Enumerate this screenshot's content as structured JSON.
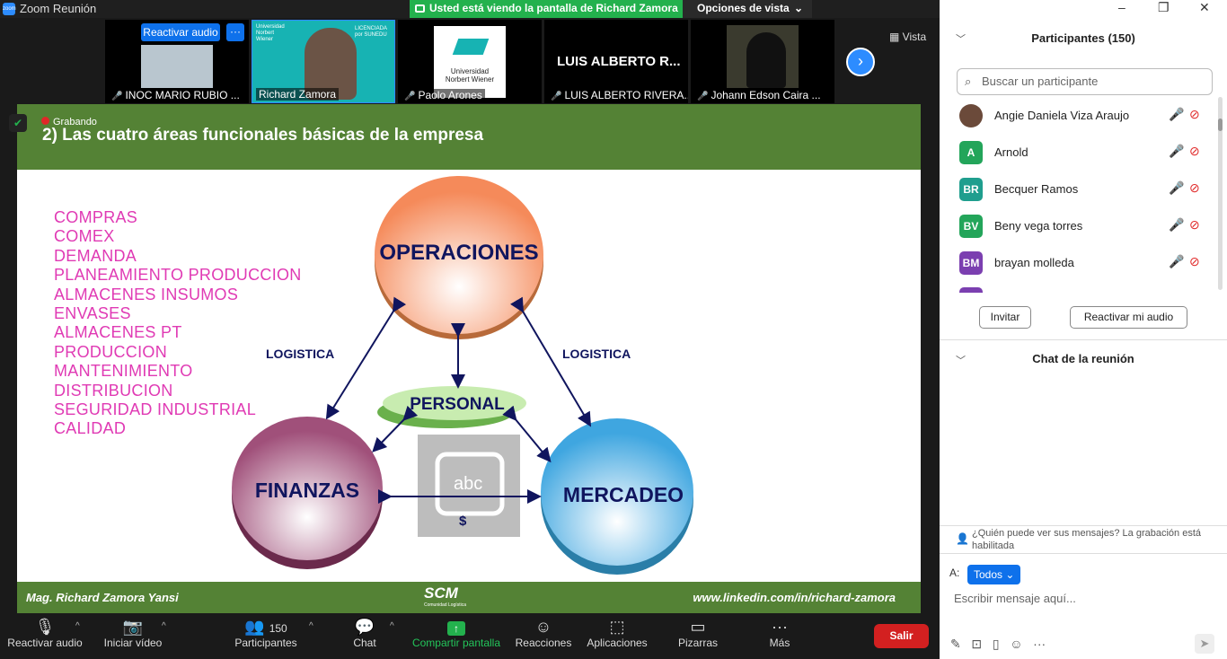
{
  "window": {
    "title": "Zoom Reunión",
    "minimize": "–",
    "restore": "❐",
    "close": "✕"
  },
  "banner": {
    "text": "Usted está viendo la pantalla de Richard Zamora"
  },
  "view_options": {
    "label": "Opciones de vista",
    "caret": "⌄"
  },
  "gallery": {
    "unmute_label": "Reactivar audio",
    "more_label": "···",
    "participants": [
      {
        "name": "INOC MARIO RUBIO ...",
        "muted": true
      },
      {
        "name": "Richard Zamora",
        "muted": false,
        "logo_top": "Universidad Norbert Wiener",
        "logo_right": "LICENCIADA por SUNEDU"
      },
      {
        "name": "Paolo Arones",
        "muted": true,
        "logo_text": "Universidad Norbert Wiener"
      },
      {
        "name": "LUIS ALBERTO RIVERA...",
        "muted": true,
        "tile_text": "LUIS ALBERTO R..."
      },
      {
        "name": "Johann Edson Caira ...",
        "muted": true
      }
    ],
    "next_arrow": "›",
    "view_label": "Vista"
  },
  "recording": {
    "label": "Grabando"
  },
  "slide": {
    "title": "2) Las cuatro áreas funcionales básicas de la empresa",
    "list": [
      "COMPRAS",
      "COMEX",
      "DEMANDA",
      "PLANEAMIENTO PRODUCCION",
      "ALMACENES INSUMOS",
      "ENVASES",
      "ALMACENES PT",
      "PRODUCCION",
      "MANTENIMIENTO",
      "DISTRIBUCION",
      "SEGURIDAD INDUSTRIAL",
      "CALIDAD"
    ],
    "circles": {
      "top": "OPERACIONES",
      "left": "FINANZAS",
      "right": "MERCADEO",
      "center": "PERSONAL"
    },
    "logistica_left": "LOGISTICA",
    "logistica_right": "LOGISTICA",
    "abc": "abc",
    "dollar": "$",
    "footer_left": "Mag. Richard Zamora Yansi",
    "footer_logo": "SCM",
    "footer_logo_sub": "Comunidad Logística",
    "footer_right": "www.linkedin.com/in/richard-zamora"
  },
  "toolbar": {
    "unmute": "Reactivar audio",
    "video": "Iniciar vídeo",
    "participants": "Participantes",
    "participants_count": "150",
    "chat": "Chat",
    "share": "Compartir pantalla",
    "reactions": "Reacciones",
    "apps": "Aplicaciones",
    "whiteboards": "Pizarras",
    "more": "Más",
    "leave": "Salir"
  },
  "panel": {
    "participants_title": "Participantes (150)",
    "search_placeholder": "Buscar un participante",
    "people": [
      {
        "initials": "",
        "name": "Angie Daniela Viza Araujo",
        "color": "#6b4a3a"
      },
      {
        "initials": "A",
        "name": "Arnold",
        "color": "#23a55a"
      },
      {
        "initials": "BR",
        "name": "Becquer Ramos",
        "color": "#1f9e8e"
      },
      {
        "initials": "BV",
        "name": "Beny vega torres",
        "color": "#23a55a"
      },
      {
        "initials": "BM",
        "name": "brayan molleda",
        "color": "#7b3fb0"
      }
    ],
    "invite": "Invitar",
    "unmute_me": "Reactivar mi audio",
    "chat_title": "Chat de la reunión",
    "chat_note": "¿Quién puede ver sus mensajes? La grabación está habilitada",
    "to_label": "A:",
    "to_value": "Todos",
    "input_placeholder": "Escribir mensaje aquí..."
  }
}
